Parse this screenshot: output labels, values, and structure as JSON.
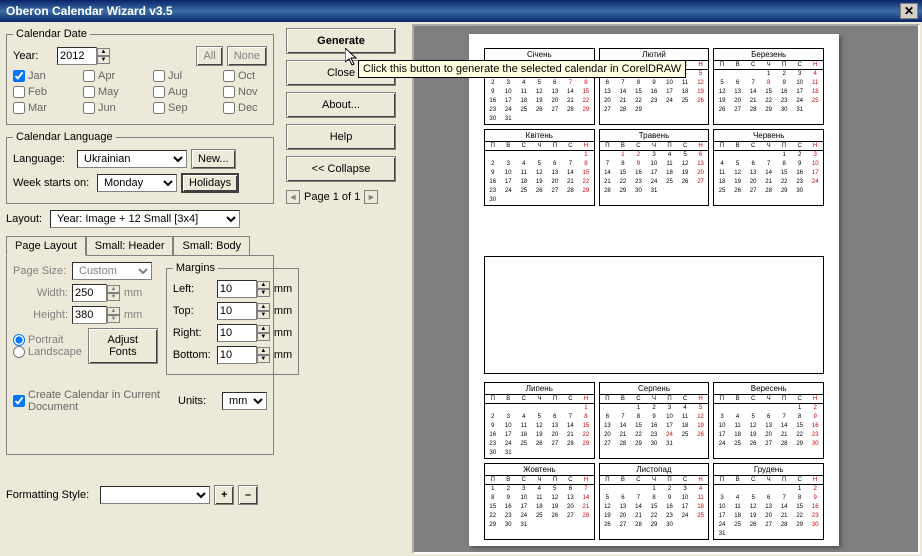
{
  "window": {
    "title": "Oberon Calendar Wizard v3.5"
  },
  "calendar_date": {
    "legend": "Calendar Date",
    "year_label": "Year:",
    "year_value": "2012",
    "all_btn": "All",
    "none_btn": "None",
    "months": [
      {
        "label": "Jan",
        "checked": true
      },
      {
        "label": "Apr",
        "checked": false
      },
      {
        "label": "Jul",
        "checked": false
      },
      {
        "label": "Oct",
        "checked": false
      },
      {
        "label": "Feb",
        "checked": false
      },
      {
        "label": "May",
        "checked": false
      },
      {
        "label": "Aug",
        "checked": false
      },
      {
        "label": "Nov",
        "checked": false
      },
      {
        "label": "Mar",
        "checked": false
      },
      {
        "label": "Jun",
        "checked": false
      },
      {
        "label": "Sep",
        "checked": false
      },
      {
        "label": "Dec",
        "checked": false
      }
    ]
  },
  "calendar_language": {
    "legend": "Calendar Language",
    "lang_label": "Language:",
    "lang_value": "Ukrainian",
    "new_btn": "New...",
    "week_label": "Week starts on:",
    "week_value": "Monday",
    "holidays_btn": "Holidays"
  },
  "layout": {
    "label": "Layout:",
    "value": "Year: Image + 12 Small [3x4]"
  },
  "buttons": {
    "generate": "Generate",
    "close": "Close",
    "about": "About...",
    "help": "Help",
    "collapse": "<< Collapse"
  },
  "tooltip": "Click this button to generate the selected calendar in CorelDRAW",
  "page_nav": {
    "text": "Page 1 of 1"
  },
  "tabs": {
    "t1": "Page Layout",
    "t2": "Small: Header",
    "t3": "Small: Body"
  },
  "page_layout": {
    "page_size_label": "Page Size:",
    "page_size_value": "Custom",
    "width_label": "Width:",
    "width_value": "250",
    "height_label": "Height:",
    "height_value": "380",
    "unit_wh": "mm",
    "portrait": "Portrait",
    "landscape": "Landscape",
    "adjust_fonts": "Adjust Fonts",
    "margins_legend": "Margins",
    "left_label": "Left:",
    "top_label": "Top:",
    "right_label": "Right:",
    "bottom_label": "Bottom:",
    "margin_val": "10",
    "margin_unit": "mm",
    "create_chk": "Create Calendar in Current Document",
    "units_label": "Units:",
    "units_value": "mm"
  },
  "formatting": {
    "label": "Formatting Style:",
    "value": "",
    "plus": "+",
    "minus": "–"
  },
  "preview": {
    "dow": [
      "П",
      "В",
      "С",
      "Ч",
      "П",
      "С",
      "Н"
    ],
    "months": [
      {
        "name": "Січень",
        "start": 6,
        "ndays": 31,
        "hol": [
          1,
          7
        ]
      },
      {
        "name": "Лютий",
        "start": 2,
        "ndays": 29,
        "hol": []
      },
      {
        "name": "Березень",
        "start": 3,
        "ndays": 31,
        "hol": [
          8
        ]
      },
      {
        "name": "Квітень",
        "start": 6,
        "ndays": 30,
        "hol": []
      },
      {
        "name": "Травень",
        "start": 1,
        "ndays": 31,
        "hol": [
          1,
          2,
          9
        ]
      },
      {
        "name": "Червень",
        "start": 4,
        "ndays": 30,
        "hol": []
      },
      {
        "name": "Липень",
        "start": 6,
        "ndays": 31,
        "hol": []
      },
      {
        "name": "Серпень",
        "start": 2,
        "ndays": 31,
        "hol": [
          24
        ]
      },
      {
        "name": "Вересень",
        "start": 5,
        "ndays": 30,
        "hol": []
      },
      {
        "name": "Жовтень",
        "start": 0,
        "ndays": 31,
        "hol": []
      },
      {
        "name": "Листопад",
        "start": 3,
        "ndays": 30,
        "hol": []
      },
      {
        "name": "Грудень",
        "start": 5,
        "ndays": 31,
        "hol": []
      }
    ]
  }
}
